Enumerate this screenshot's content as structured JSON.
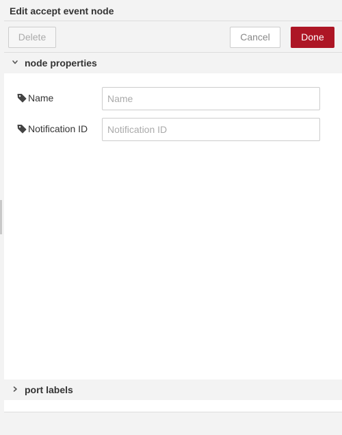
{
  "tray": {
    "title": "Edit accept event node"
  },
  "toolbar": {
    "delete_label": "Delete",
    "cancel_label": "Cancel",
    "done_label": "Done"
  },
  "sections": {
    "node_properties": {
      "label": "node properties",
      "state": "expanded",
      "icon": "chevron-down-icon"
    },
    "port_labels": {
      "label": "port labels",
      "state": "collapsed",
      "icon": "chevron-right-icon"
    }
  },
  "fields": {
    "name": {
      "label": "Name",
      "value": "",
      "placeholder": "Name",
      "icon": "tag-icon"
    },
    "notification_id": {
      "label": "Notification ID",
      "value": "",
      "placeholder": "Notification ID",
      "icon": "tag-icon"
    }
  },
  "colors": {
    "primary": "#ad1625",
    "panel_bg": "#f3f3f3",
    "content_bg": "#ffffff",
    "border": "#cccccc"
  }
}
